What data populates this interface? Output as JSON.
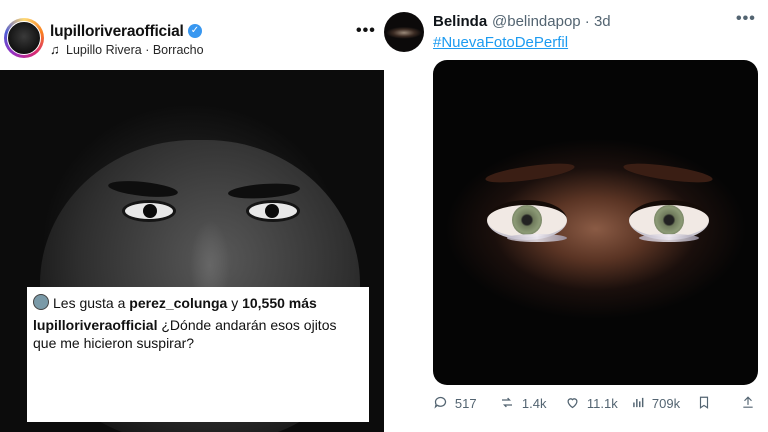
{
  "instagram_post": {
    "username": "lupilloriveraofficial",
    "verified_mark": "✓",
    "music_icon": "♫",
    "audio": "Lupillo Rivera · Borracho",
    "more_icon": "•••",
    "likes": {
      "prefix": "Les gusta a ",
      "user": "perez_colunga",
      "middle": " y ",
      "count": "10,550 más"
    },
    "caption": {
      "user": "lupilloriveraofficial",
      "text": "¿Dónde andarán esos ojitos que me hicieron suspirar?"
    }
  },
  "twitter_post": {
    "name": "Belinda",
    "handle_time": "@belindapop · 3d",
    "more_icon": "•••",
    "hashtag": "#NuevaFotoDePerfil",
    "actions": {
      "replies": "517",
      "reposts": "1.4k",
      "likes": "11.1k",
      "views": "709k"
    },
    "icons": {
      "reply": "reply-icon",
      "repost": "repost-icon",
      "like": "heart-icon",
      "views": "views-icon",
      "bookmark": "bookmark-icon",
      "share": "share-icon"
    }
  }
}
